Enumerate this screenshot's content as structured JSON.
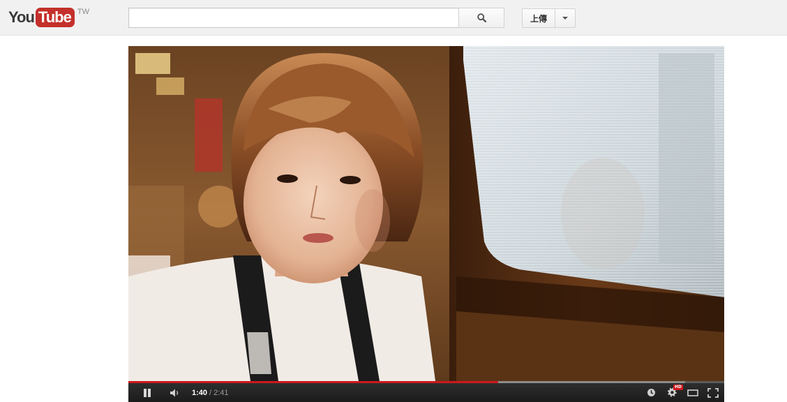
{
  "masthead": {
    "logo_you": "You",
    "logo_tube": "Tube",
    "logo_region": "TW",
    "search_value": "",
    "search_icon": "search-icon",
    "upload_label": "上傳",
    "upload_menu_icon": "caret-down-icon"
  },
  "player": {
    "time_current": "1:40",
    "time_separator": "/",
    "time_duration": "2:41",
    "progress_played": 0.621,
    "progress_loaded": 0.935,
    "hd_badge": "HD",
    "icons": {
      "pause": "pause-icon",
      "volume": "volume-icon",
      "watch_later": "clock-icon",
      "settings": "gear-icon",
      "theater": "theater-mode-icon",
      "fullscreen": "fullscreen-icon"
    },
    "colors": {
      "progress_played": "#cc181e",
      "logo_red": "#c4302b"
    }
  }
}
